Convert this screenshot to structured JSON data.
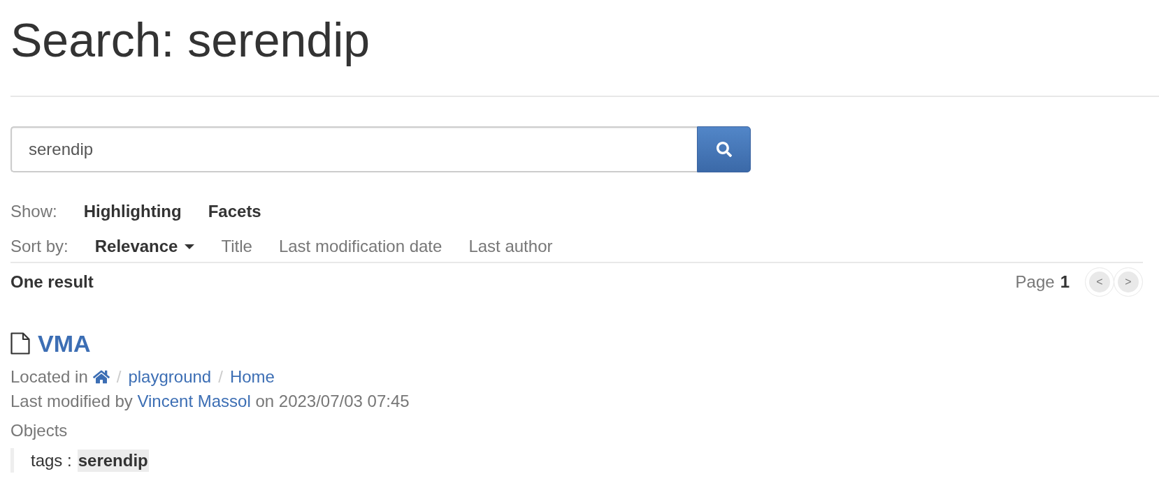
{
  "header": {
    "title": "Search: serendip"
  },
  "search": {
    "value": "serendip"
  },
  "show": {
    "label": "Show:",
    "options": [
      {
        "label": "Highlighting"
      },
      {
        "label": "Facets"
      }
    ]
  },
  "sort": {
    "label": "Sort by:",
    "options": [
      {
        "label": "Relevance",
        "selected": true
      },
      {
        "label": "Title",
        "selected": false
      },
      {
        "label": "Last modification date",
        "selected": false
      },
      {
        "label": "Last author",
        "selected": false
      }
    ]
  },
  "results_bar": {
    "summary": "One result",
    "page_label": "Page",
    "page_number": "1",
    "pager": [
      {
        "label": "<",
        "disabled": true
      },
      {
        "label": ">",
        "disabled": true
      }
    ]
  },
  "results": [
    {
      "title": "VMA",
      "location": {
        "label": "Located in",
        "items": [
          {
            "kind": "home"
          },
          {
            "kind": "page",
            "separator": "/",
            "label": "playground"
          },
          {
            "kind": "page",
            "separator": "/",
            "label": "Home"
          }
        ]
      },
      "modified": {
        "prefix": "Last modified by",
        "author": "Vincent Massol",
        "suffix": "on 2023/07/03 07:45"
      },
      "objects": {
        "label": "Objects",
        "fields": [
          {
            "name": "tags :",
            "value": "serendip"
          }
        ]
      }
    }
  ]
}
